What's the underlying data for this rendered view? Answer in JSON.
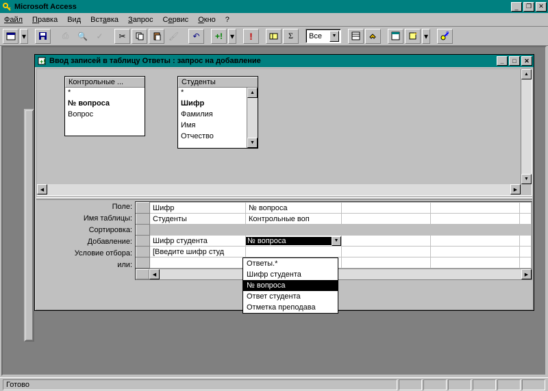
{
  "app": {
    "title": "Microsoft Access",
    "status": "Готово"
  },
  "menu": {
    "file": "Файл",
    "edit": "Правка",
    "view": "Вид",
    "insert": "Вставка",
    "query": "Запрос",
    "service": "Сервис",
    "window": "Окно",
    "help": "?"
  },
  "toolbar": {
    "combo_value": "Все"
  },
  "child": {
    "title": "Ввод записей в таблицу Ответы : запрос на добавление"
  },
  "tables": {
    "t1": {
      "header": "Контрольные ...",
      "rows": [
        "*",
        "№ вопроса",
        "Вопрос"
      ]
    },
    "t2": {
      "header": "Студенты",
      "rows": [
        "*",
        "Шифр",
        "Фамилия",
        "Имя",
        "Отчество"
      ]
    }
  },
  "grid": {
    "labels": {
      "field": "Поле:",
      "table": "Имя таблицы:",
      "sort": "Сортировка:",
      "append": "Добавление:",
      "criteria": "Условие отбора:",
      "or": "или:"
    },
    "cols": [
      {
        "field": "Шифр",
        "table": "Студенты",
        "append": "Шифр студента",
        "criteria": "[Введите шифр студ"
      },
      {
        "field": "№ вопроса",
        "table": "Контрольные воп",
        "append": "№ вопроса",
        "criteria": ""
      }
    ]
  },
  "dropdown": {
    "items": [
      "Ответы.*",
      "Шифр студента",
      "№ вопроса",
      "Ответ студента",
      "Отметка преподава"
    ]
  }
}
